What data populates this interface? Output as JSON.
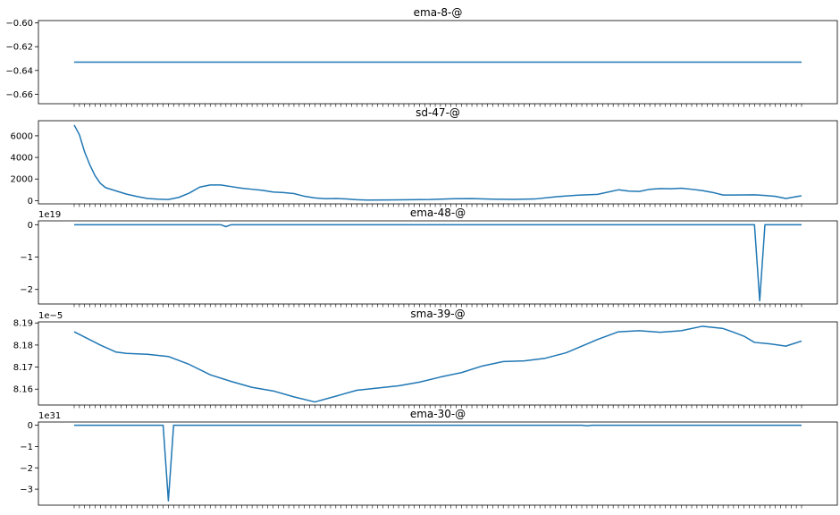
{
  "chart_data": [
    {
      "type": "line",
      "title": "ema-8-@",
      "offset_text": "",
      "ylim": [
        -0.668,
        -0.598
      ],
      "yticks": [
        -0.66,
        -0.64,
        -0.62,
        -0.6
      ],
      "ytick_labels": [
        "−0.66",
        "−0.64",
        "−0.62",
        "−0.60"
      ],
      "n_points": 140,
      "series": [
        {
          "x": [
            0,
            139
          ],
          "values": [
            -0.633,
            -0.633
          ]
        }
      ]
    },
    {
      "type": "line",
      "title": "sd-47-@",
      "offset_text": "",
      "ylim": [
        -300,
        7400
      ],
      "yticks": [
        0,
        2000,
        4000,
        6000
      ],
      "ytick_labels": [
        "0",
        "2000",
        "4000",
        "6000"
      ],
      "n_points": 140,
      "series": [
        {
          "x": [
            0,
            1,
            2,
            3,
            4,
            5,
            6,
            8,
            10,
            12,
            14,
            16,
            18,
            20,
            22,
            24,
            26,
            28,
            30,
            32,
            34,
            36,
            38,
            40,
            42,
            44,
            46,
            48,
            50,
            52,
            54,
            56,
            60,
            64,
            68,
            72,
            76,
            80,
            84,
            88,
            92,
            96,
            100,
            104,
            106,
            108,
            110,
            112,
            114,
            116,
            118,
            120,
            122,
            124,
            126,
            128,
            130,
            132,
            134,
            136,
            139
          ],
          "values": [
            7000,
            6100,
            4500,
            3300,
            2300,
            1600,
            1200,
            900,
            600,
            380,
            200,
            130,
            100,
            300,
            700,
            1250,
            1450,
            1450,
            1300,
            1150,
            1050,
            950,
            800,
            750,
            650,
            400,
            250,
            180,
            200,
            150,
            80,
            50,
            60,
            80,
            100,
            170,
            190,
            130,
            110,
            150,
            350,
            500,
            580,
            1000,
            880,
            850,
            1050,
            1120,
            1100,
            1150,
            1050,
            930,
            760,
            520,
            520,
            530,
            540,
            480,
            390,
            200,
            450
          ]
        }
      ]
    },
    {
      "type": "line",
      "title": "ema-48-@",
      "offset_text": "1e19",
      "ylim": [
        -2.45,
        0.12
      ],
      "yticks": [
        -2,
        -1,
        0
      ],
      "ytick_labels": [
        "−2",
        "−1",
        "0"
      ],
      "n_points": 140,
      "series": [
        {
          "x": [
            0,
            28,
            29,
            30,
            130,
            131,
            132,
            139
          ],
          "values": [
            0,
            0,
            -0.06,
            0,
            0,
            -2.35,
            0,
            0
          ]
        }
      ]
    },
    {
      "type": "line",
      "title": "sma-39-@",
      "offset_text": "1e−5",
      "ylim": [
        8.1528,
        8.1905
      ],
      "yticks": [
        8.16,
        8.17,
        8.18,
        8.19
      ],
      "ytick_labels": [
        "8.16",
        "8.17",
        "8.18",
        "8.19"
      ],
      "n_points": 140,
      "series": [
        {
          "x": [
            0,
            5,
            8,
            10,
            14,
            18,
            22,
            26,
            30,
            34,
            38,
            42,
            46,
            50,
            54,
            58,
            62,
            66,
            70,
            74,
            78,
            82,
            86,
            90,
            94,
            98,
            100,
            104,
            108,
            112,
            116,
            120,
            124,
            126,
            128,
            130,
            133,
            136,
            139
          ],
          "values": [
            8.186,
            8.18,
            8.1768,
            8.1762,
            8.1758,
            8.1748,
            8.1712,
            8.1665,
            8.1635,
            8.1608,
            8.1592,
            8.1565,
            8.1542,
            8.1568,
            8.1595,
            8.1605,
            8.1615,
            8.1632,
            8.1655,
            8.1675,
            8.1705,
            8.1725,
            8.1728,
            8.174,
            8.1765,
            8.1805,
            8.1825,
            8.186,
            8.1865,
            8.1858,
            8.1865,
            8.1885,
            8.1875,
            8.1858,
            8.184,
            8.1812,
            8.1805,
            8.1795,
            8.1818
          ]
        }
      ]
    },
    {
      "type": "line",
      "title": "ema-30-@",
      "offset_text": "1e31",
      "ylim": [
        -3.75,
        0.15
      ],
      "yticks": [
        -3,
        -2,
        -1,
        0
      ],
      "ytick_labels": [
        "−3",
        "−2",
        "−1",
        "0"
      ],
      "n_points": 140,
      "series": [
        {
          "x": [
            0,
            17,
            18,
            19,
            97,
            98,
            99,
            139
          ],
          "values": [
            0,
            0,
            -3.55,
            0,
            0,
            -0.03,
            0,
            0
          ]
        }
      ]
    }
  ]
}
